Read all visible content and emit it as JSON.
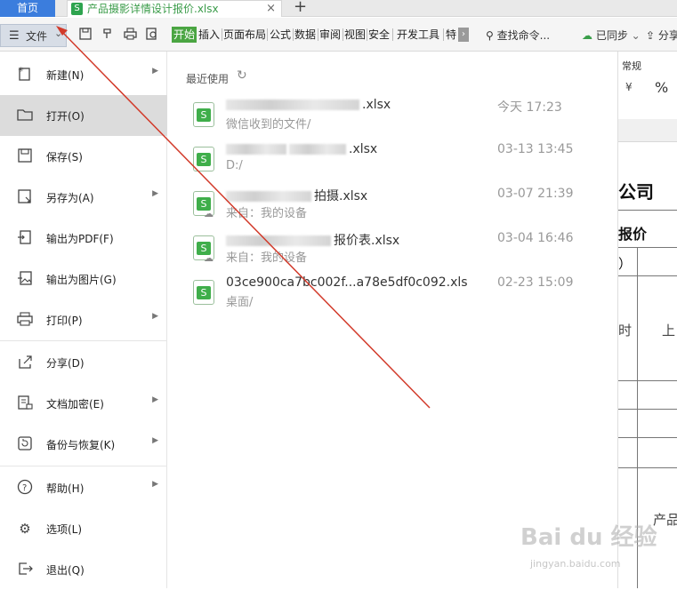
{
  "tabs": {
    "home_label": "首页",
    "doc_icon": "S",
    "doc_title": "产品摄影详情设计报价.xlsx",
    "close_glyph": "×",
    "new_tab_glyph": "+"
  },
  "toolbar": {
    "file_menu_label": "文件",
    "ribbon_tabs": [
      "开始",
      "插入",
      "页面布局",
      "公式",
      "数据",
      "审阅",
      "视图",
      "安全",
      "开发工具",
      "特"
    ],
    "search_label": "查找命令...",
    "sync_label": "已同步",
    "share_label": "分享"
  },
  "file_menu": {
    "items": [
      {
        "label": "新建(N)",
        "icon": "new-file-icon",
        "submenu": true
      },
      {
        "label": "打开(O)",
        "icon": "folder-open-icon",
        "submenu": false,
        "active": true
      },
      {
        "label": "保存(S)",
        "icon": "save-icon",
        "submenu": false
      },
      {
        "label": "另存为(A)",
        "icon": "save-as-icon",
        "submenu": true
      },
      {
        "label": "输出为PDF(F)",
        "icon": "pdf-export-icon",
        "submenu": false
      },
      {
        "label": "输出为图片(G)",
        "icon": "image-export-icon",
        "submenu": false
      },
      {
        "label": "打印(P)",
        "icon": "printer-icon",
        "submenu": true
      },
      {
        "label": "分享(D)",
        "icon": "share-icon",
        "submenu": false
      },
      {
        "label": "文档加密(E)",
        "icon": "lock-document-icon",
        "submenu": true
      },
      {
        "label": "备份与恢复(K)",
        "icon": "backup-icon",
        "submenu": true
      },
      {
        "label": "帮助(H)",
        "icon": "help-icon",
        "submenu": true
      },
      {
        "label": "选项(L)",
        "icon": "gear-icon",
        "submenu": false
      },
      {
        "label": "退出(Q)",
        "icon": "exit-icon",
        "submenu": false
      }
    ]
  },
  "recent": {
    "title": "最近使用",
    "files": [
      {
        "name_visible": ".xlsx",
        "path": "微信收到的文件/",
        "time": "今天 17:23"
      },
      {
        "name_visible": ".xlsx",
        "path": "D:/",
        "time": "03-13 13:45"
      },
      {
        "name_visible": "拍摄.xlsx",
        "path": "来自：我的设备",
        "time": "03-07 21:39"
      },
      {
        "name_visible": "报价表.xlsx",
        "path": "来自：我的设备",
        "time": "03-04 16:46"
      },
      {
        "name_visible": "03ce900ca7bc002f...a78e5df0c092.xls",
        "path": "桌面/",
        "time": "02-23 15:09"
      }
    ]
  },
  "sheet": {
    "number_format": "常规",
    "currency_glyph": "¥",
    "percent_glyph": "%",
    "cells": [
      "公司",
      "报价",
      "）",
      "时",
      "上",
      "产品"
    ]
  },
  "watermark": {
    "main": "Bai du 经验",
    "sub": "jingyan.baidu.com"
  },
  "colors": {
    "accent_blue": "#3b7ddd",
    "ribbon_green": "#4aa542",
    "annotation_red": "#d23a2a"
  }
}
